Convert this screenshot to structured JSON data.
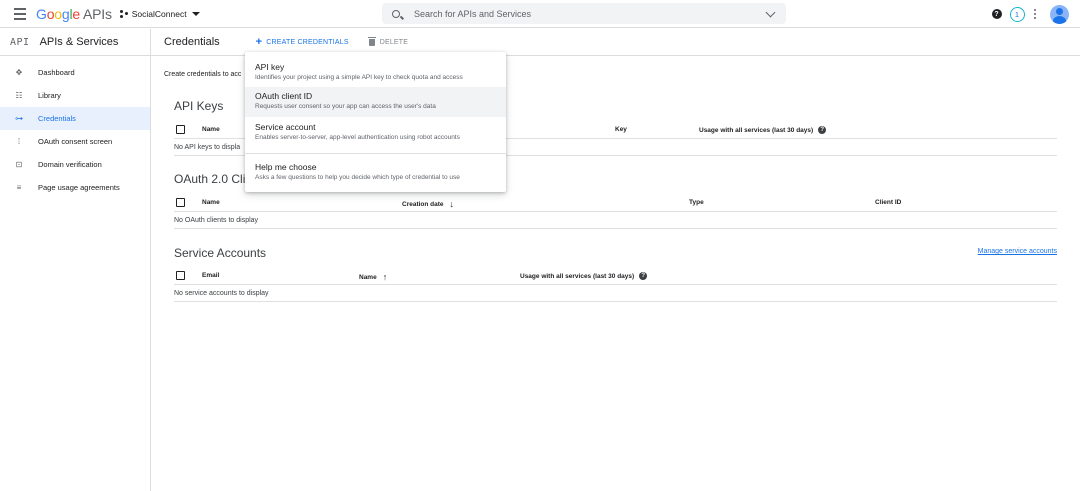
{
  "brand": {
    "google": "Google",
    "apis": "APIs",
    "project": "SocialConnect"
  },
  "search": {
    "placeholder": "Search for APIs and Services"
  },
  "topbar": {
    "notification_count": "1"
  },
  "sidebar": {
    "glyph": "API",
    "title": "APIs & Services",
    "items": [
      {
        "label": "Dashboard",
        "icon": "dashboard-icon",
        "active": false
      },
      {
        "label": "Library",
        "icon": "library-icon",
        "active": false
      },
      {
        "label": "Credentials",
        "icon": "key-icon",
        "active": true
      },
      {
        "label": "OAuth consent screen",
        "icon": "consent-icon",
        "active": false
      },
      {
        "label": "Domain verification",
        "icon": "checkbox-icon",
        "active": false
      },
      {
        "label": "Page usage agreements",
        "icon": "settings-list-icon",
        "active": false
      }
    ]
  },
  "header": {
    "title": "Credentials",
    "create_label": "CREATE CREDENTIALS",
    "delete_label": "DELETE"
  },
  "intro": "Create credentials to acc",
  "api_keys": {
    "title": "API Keys",
    "columns": [
      "Name",
      "Key",
      "Usage with all services (last 30 days)"
    ],
    "empty": "No API keys to displa"
  },
  "oauth": {
    "title": "OAuth 2.0 Clie",
    "columns": [
      "Name",
      "Creation date",
      "Type",
      "Client ID"
    ],
    "empty": "No OAuth clients to display"
  },
  "service_accounts": {
    "title": "Service Accounts",
    "manage_link": "Manage service accounts",
    "columns": [
      "Email",
      "Name",
      "Usage with all services (last 30 days)"
    ],
    "empty": "No service accounts to display"
  },
  "dropdown": {
    "items": [
      {
        "title": "API key",
        "desc": "Identifies your project using a simple API key to check quota and access"
      },
      {
        "title": "OAuth client ID",
        "desc": "Requests user consent so your app can access the user's data"
      },
      {
        "title": "Service account",
        "desc": "Enables server-to-server, app-level authentication using robot accounts"
      },
      {
        "title": "Help me choose",
        "desc": "Asks a few questions to help you decide which type of credential to use"
      }
    ]
  },
  "colors": {
    "accent": "#1a73e8",
    "active_bg": "#e8f0fe",
    "notification_ring": "#12b5cb"
  }
}
